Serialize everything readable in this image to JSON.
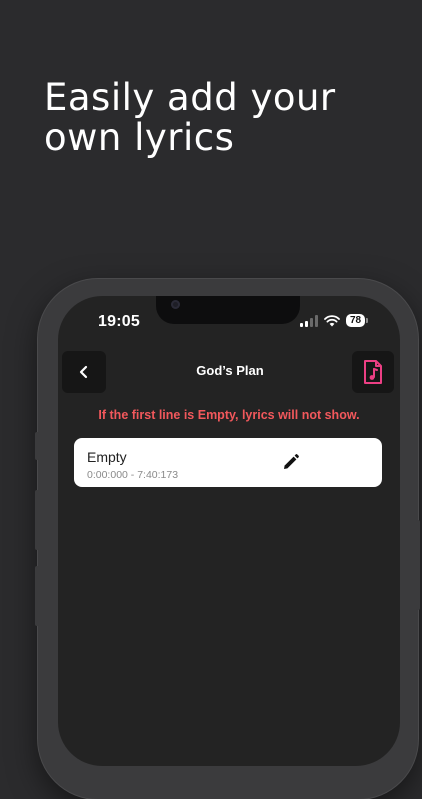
{
  "headline": {
    "line1": "Easily add your",
    "line2": "own lyrics"
  },
  "status_bar": {
    "time": "19:05",
    "battery": "78"
  },
  "header": {
    "title": "God’s Plan"
  },
  "warning": "If the first line is Empty, lyrics will not show.",
  "lyrics": [
    {
      "text": "Empty",
      "time_range": "0:00:000 - 7:40:173"
    }
  ],
  "colors": {
    "background": "#2b2b2d",
    "warning_text": "#f2585c",
    "file_icon_accent": "#ec3f84",
    "card_background": "#ffffff"
  },
  "icons": {
    "back": "chevron-left-icon",
    "file": "music-file-icon",
    "edit": "pencil-icon",
    "signal": "cellular-signal-icon",
    "wifi": "wifi-icon",
    "battery": "battery-icon"
  }
}
